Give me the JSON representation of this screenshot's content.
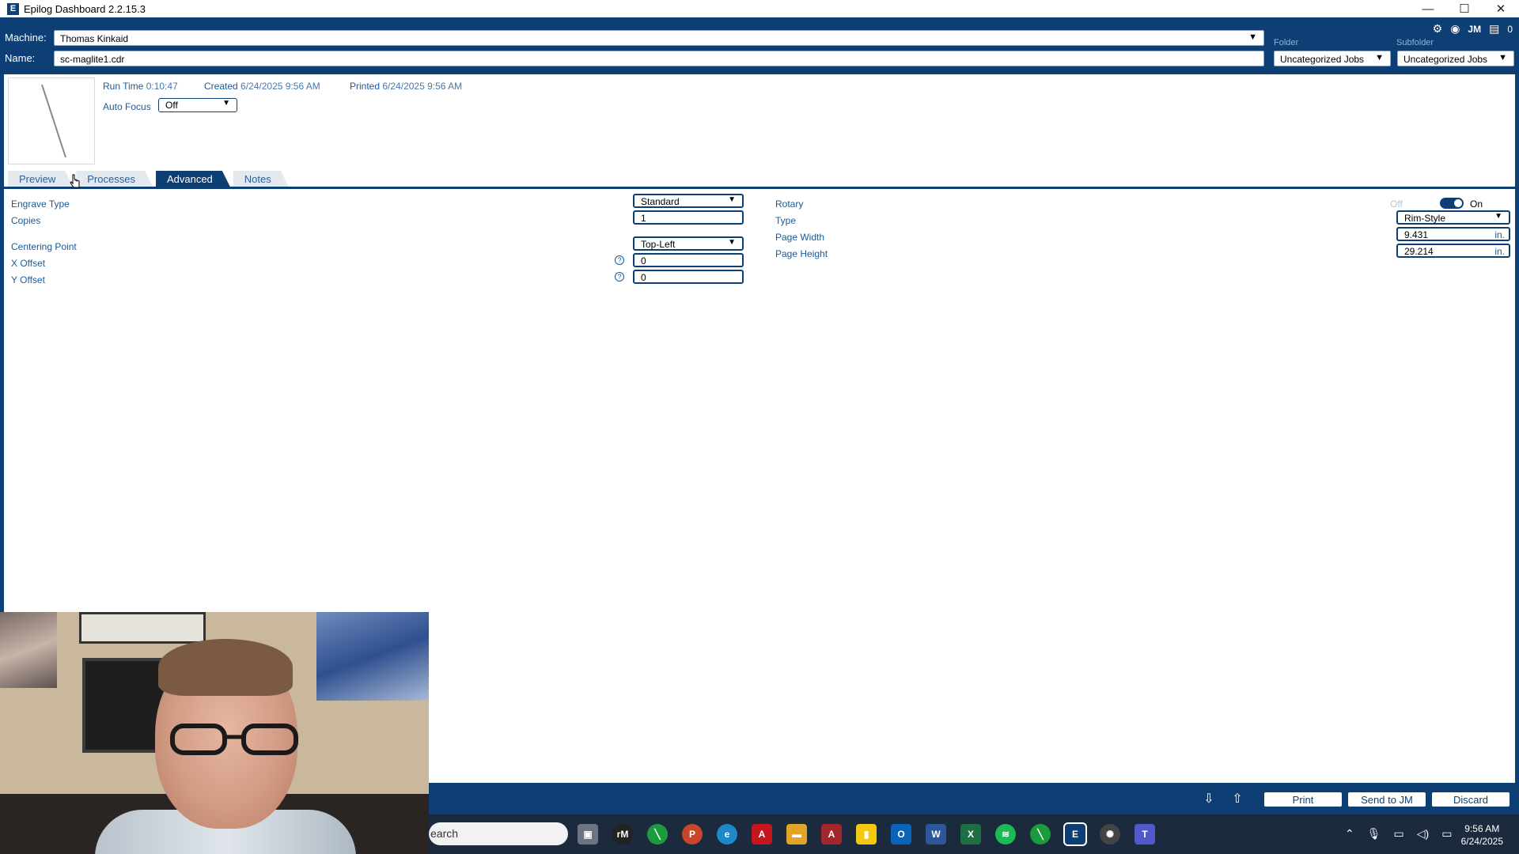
{
  "window": {
    "title": "Epilog Dashboard 2.2.15.3",
    "icon_letter": "E",
    "minimize": "—",
    "maximize": "☐",
    "close": "✕"
  },
  "header": {
    "machine_label": "Machine:",
    "machine_value": "Thomas Kinkaid",
    "name_label": "Name:",
    "name_value": "sc-maglite1.cdr",
    "folder_label": "Folder",
    "folder_value": "Uncategorized Jobs",
    "subfolder_label": "Subfolder",
    "subfolder_value": "Uncategorized Jobs",
    "user_initials": "JM",
    "queue_count": "0"
  },
  "job": {
    "run_time_label": "Run Time",
    "run_time_value": "0:10:47",
    "created_label": "Created",
    "created_value": "6/24/2025 9:56 AM",
    "printed_label": "Printed",
    "printed_value": "6/24/2025 9:56 AM",
    "auto_focus_label": "Auto Focus",
    "auto_focus_value": "Off"
  },
  "tabs": [
    {
      "label": "Preview",
      "active": false
    },
    {
      "label": "Processes",
      "active": false
    },
    {
      "label": "Advanced",
      "active": true
    },
    {
      "label": "Notes",
      "active": false
    }
  ],
  "advanced": {
    "engrave_type_label": "Engrave Type",
    "engrave_type_value": "Standard",
    "copies_label": "Copies",
    "copies_value": "1",
    "centering_point_label": "Centering Point",
    "centering_point_value": "Top-Left",
    "x_offset_label": "X Offset",
    "x_offset_value": "0",
    "y_offset_label": "Y Offset",
    "y_offset_value": "0",
    "help_glyph": "?",
    "rotary_label": "Rotary",
    "rotary_off": "Off",
    "rotary_on": "On",
    "rotary_enabled": true,
    "type_label": "Type",
    "type_value": "Rim-Style",
    "page_width_label": "Page Width",
    "page_width_value": "9.431",
    "page_height_label": "Page Height",
    "page_height_value": "29.214",
    "unit": "in."
  },
  "footer": {
    "print_label": "Print",
    "send_label": "Send to JM",
    "discard_label": "Discard"
  },
  "taskbar": {
    "search_placeholder": "earch",
    "time": "9:56 AM",
    "date": "6/24/2025"
  },
  "colors": {
    "brand_blue": "#0d3f74",
    "label_blue": "#1a5a9a"
  }
}
